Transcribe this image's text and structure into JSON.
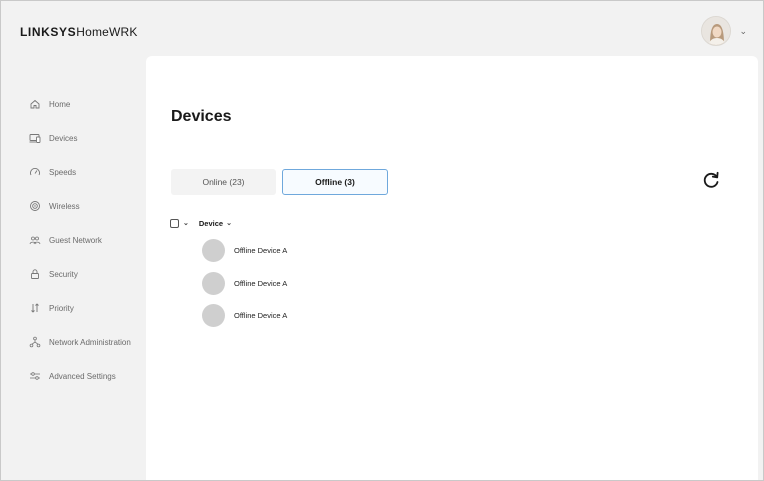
{
  "header": {
    "brand": "LINKSYS",
    "product": "HomeWRK"
  },
  "sidebar": {
    "items": [
      {
        "label": "Home",
        "icon": "home-icon"
      },
      {
        "label": "Devices",
        "icon": "devices-icon"
      },
      {
        "label": "Speeds",
        "icon": "speedometer-icon"
      },
      {
        "label": "Wireless",
        "icon": "wifi-icon"
      },
      {
        "label": "Guest Network",
        "icon": "guest-icon"
      },
      {
        "label": "Security",
        "icon": "lock-icon"
      },
      {
        "label": "Priority",
        "icon": "priority-arrows-icon"
      },
      {
        "label": "Network Administration",
        "icon": "network-icon"
      },
      {
        "label": "Advanced Settings",
        "icon": "sliders-icon"
      }
    ]
  },
  "main": {
    "title": "Devices",
    "tabs": [
      {
        "label": "Online (23)",
        "selected": false
      },
      {
        "label": "Offline (3)",
        "selected": true
      }
    ],
    "list_header": {
      "device": "Device"
    },
    "devices": [
      {
        "name": "Offline Device A"
      },
      {
        "name": "Offline Device A"
      },
      {
        "name": "Offline Device A"
      }
    ]
  },
  "colors": {
    "selected_tab_border": "#6fa8dc",
    "background": "#f2f2f2",
    "device_avatar": "#cfcfcf"
  }
}
